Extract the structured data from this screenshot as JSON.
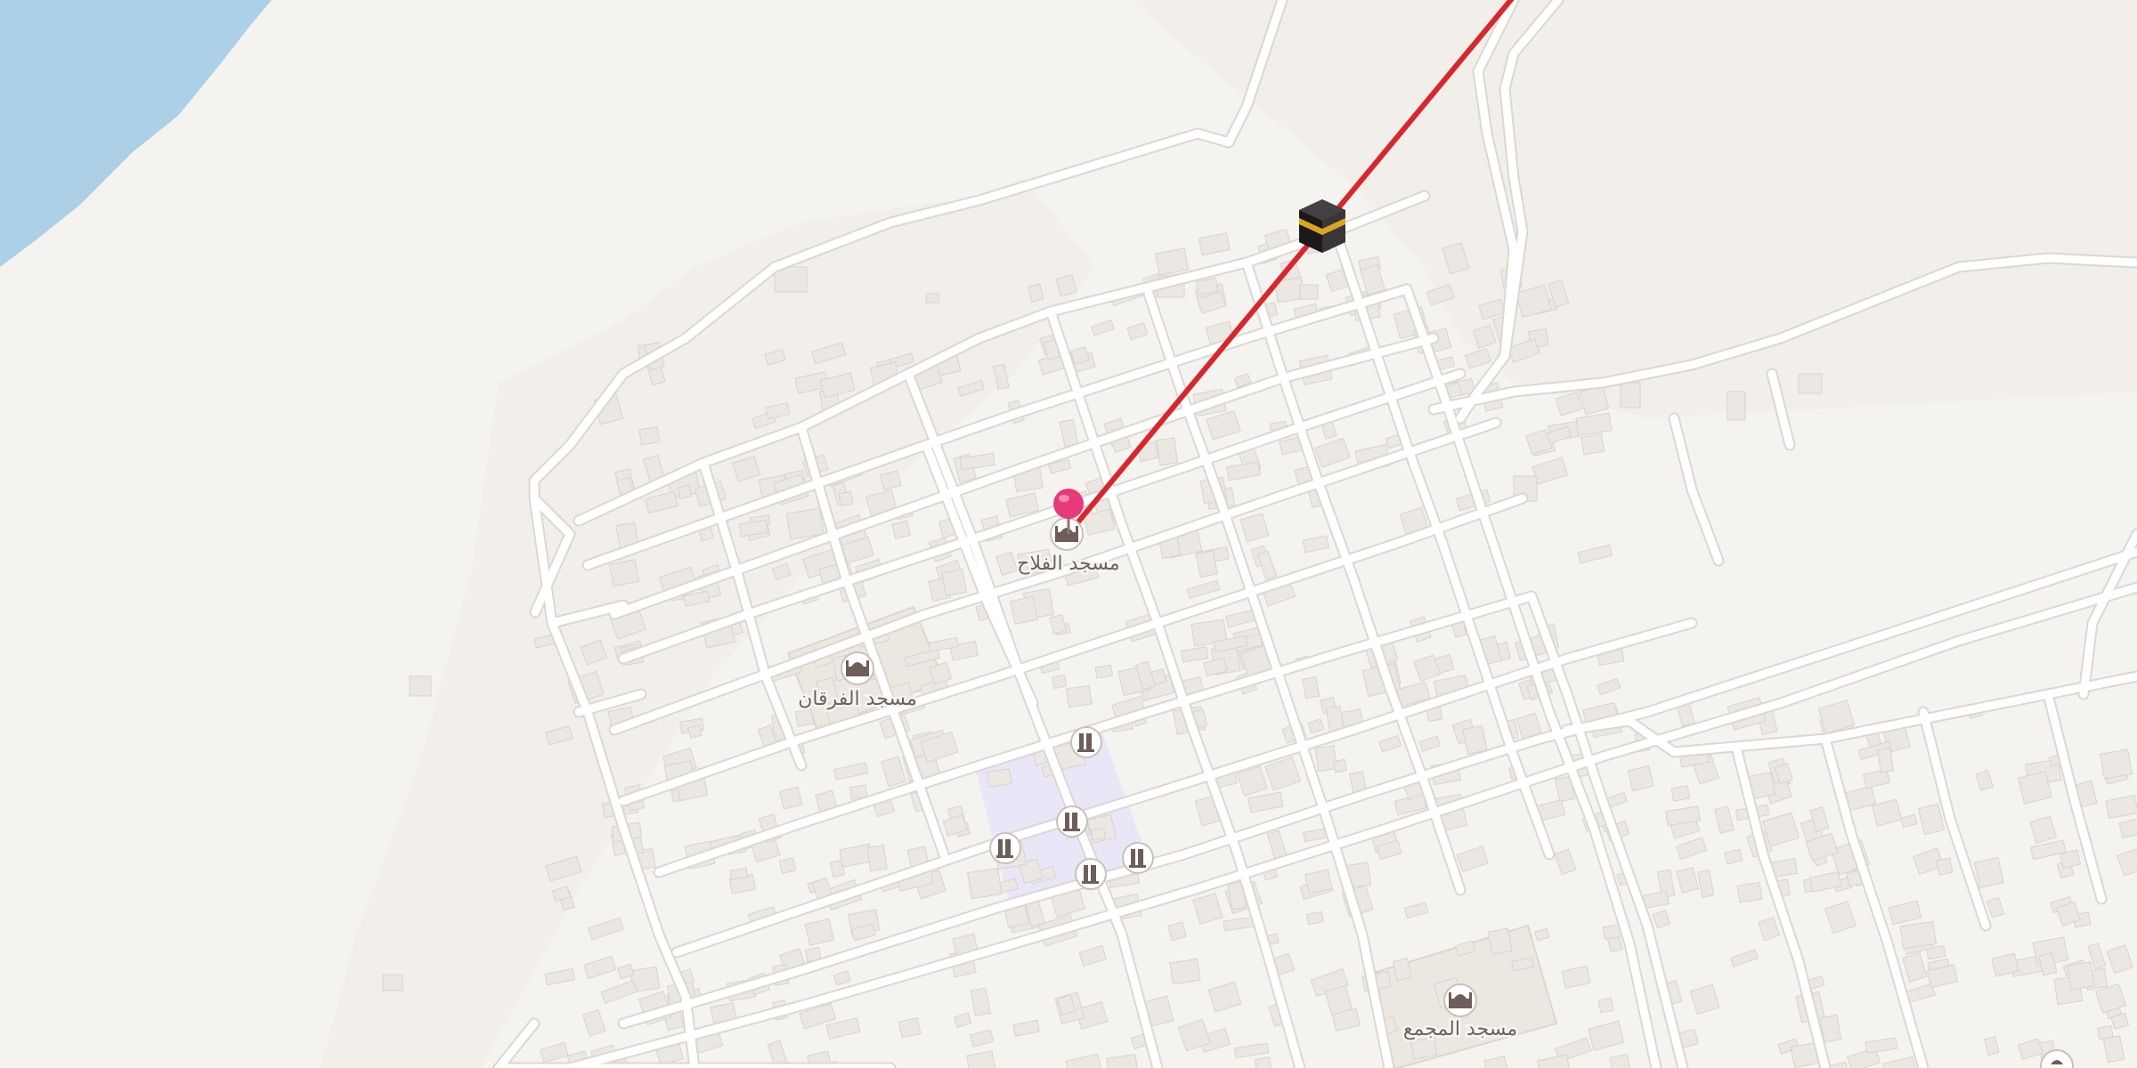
{
  "map": {
    "colors": {
      "land": "#f5f3f0",
      "water": "#acd0e6",
      "road": "#ffffff",
      "road_casing": "#dcd7d1",
      "building": "#ebe7e2",
      "building_edge": "#d9d3cc",
      "cemetery": "#eae6f7",
      "qibla_line": "#d8262d",
      "pin": "#e63a7a",
      "poi_icon": "#6e5d58"
    },
    "qibla": {
      "label": "Qibla direction",
      "icon": "kaaba-icon"
    },
    "current_location": {
      "icon": "location-pin-icon"
    },
    "pois": [
      {
        "name": "مسجد الفلاح",
        "icon": "mosque-icon"
      },
      {
        "name": "مسجد الفرقان",
        "icon": "mosque-icon"
      },
      {
        "name": "مسجد المجمع",
        "icon": "mosque-icon"
      }
    ],
    "graves": [
      {
        "icon": "grave-icon"
      },
      {
        "icon": "grave-icon"
      },
      {
        "icon": "grave-icon"
      },
      {
        "icon": "grave-icon"
      },
      {
        "icon": "grave-icon"
      }
    ]
  }
}
